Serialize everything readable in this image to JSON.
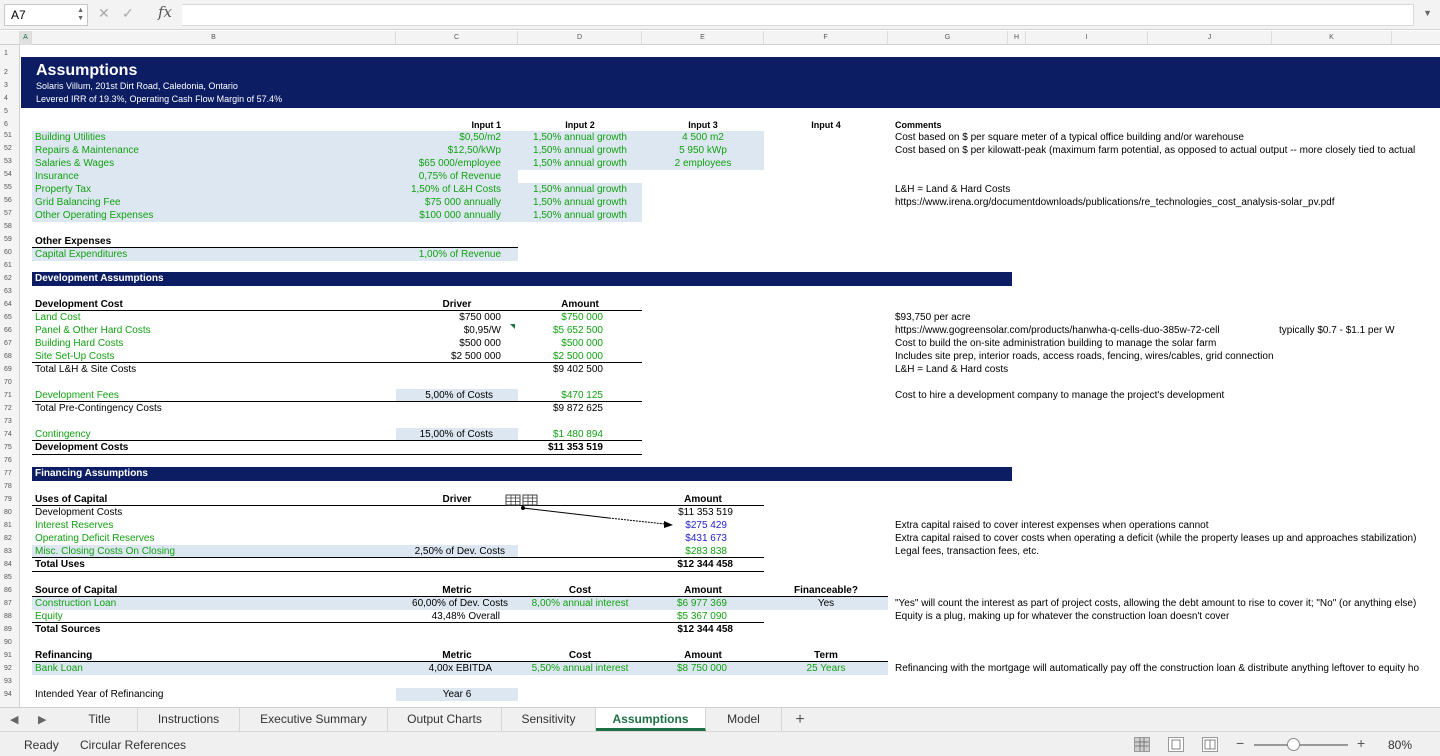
{
  "formula_bar": {
    "cell_ref": "A7",
    "formula": ""
  },
  "columns": [
    "A",
    "B",
    "C",
    "D",
    "E",
    "F",
    "G",
    "H",
    "I",
    "J",
    "K"
  ],
  "rows": [
    "1",
    "2",
    "3",
    "4",
    "5",
    "6",
    "51",
    "52",
    "53",
    "54",
    "55",
    "56",
    "57",
    "58",
    "59",
    "60",
    "61",
    "62",
    "63",
    "64",
    "65",
    "66",
    "67",
    "68",
    "69",
    "70",
    "71",
    "72",
    "73",
    "74",
    "75",
    "76",
    "77",
    "78",
    "79",
    "80",
    "81",
    "82",
    "83",
    "84",
    "85",
    "86",
    "87",
    "88",
    "89",
    "90",
    "91",
    "92",
    "93",
    "94"
  ],
  "header": {
    "title": "Assumptions",
    "subtitle": "Solaris Villum, 201st Dirt Road, Caledonia, Ontario",
    "irr_line": "Levered IRR of 19.3%, Operating Cash Flow Margin of 57.4%"
  },
  "opex": {
    "col_headers": {
      "input1": "Input 1",
      "input2": "Input 2",
      "input3": "Input 3",
      "input4": "Input 4",
      "comments": "Comments"
    },
    "rows": [
      {
        "label": "Building Utilities",
        "in1": "$0,50/m2",
        "in2": "1,50% annual growth",
        "in3": "4 500 m2",
        "comment": "Cost based on $ per square meter of a typical office building and/or warehouse"
      },
      {
        "label": "Repairs & Maintenance",
        "in1": "$12,50/kWp",
        "in2": "1,50% annual growth",
        "in3": "5 950 kWp",
        "comment": "Cost based on $ per kilowatt-peak (maximum farm potential, as opposed to actual output -- more closely tied to actual"
      },
      {
        "label": "Salaries & Wages",
        "in1": "$65 000/employee",
        "in2": "1,50% annual growth",
        "in3": "2 employees",
        "comment": ""
      },
      {
        "label": "Insurance",
        "in1": "0,75% of Revenue",
        "in2": "",
        "in3": "",
        "comment": ""
      },
      {
        "label": "Property Tax",
        "in1": "1,50% of L&H Costs",
        "in2": "1,50% annual growth",
        "in3": "",
        "comment": "L&H = Land & Hard Costs"
      },
      {
        "label": "Grid Balancing Fee",
        "in1": "$75 000 annually",
        "in2": "1,50% annual growth",
        "in3": "",
        "comment": "https://www.irena.org/documentdownloads/publications/re_technologies_cost_analysis-solar_pv.pdf"
      },
      {
        "label": "Other Operating Expenses",
        "in1": "$100 000 annually",
        "in2": "1,50% annual growth",
        "in3": "",
        "comment": ""
      }
    ]
  },
  "other_expenses": {
    "title": "Other Expenses",
    "capex_label": "Capital Expenditures",
    "capex_value": "1,00% of Revenue"
  },
  "development": {
    "band": "Development Assumptions",
    "hdr_label": "Development Cost",
    "hdr_driver": "Driver",
    "hdr_amount": "Amount",
    "rows": [
      {
        "label": "Land Cost",
        "driver": "$750 000",
        "amount": "$750 000",
        "comment": "$93,750 per acre",
        "extra": ""
      },
      {
        "label": "Panel & Other Hard Costs",
        "driver": "$0,95/W",
        "amount": "$5 652 500",
        "comment": "https://www.gogreensolar.com/products/hanwha-q-cells-duo-385w-72-cell",
        "extra": "typically $0.7 - $1.1 per W"
      },
      {
        "label": "Building Hard Costs",
        "driver": "$500 000",
        "amount": "$500 000",
        "comment": "Cost to build the on-site administration building to manage the solar farm",
        "extra": ""
      },
      {
        "label": "Site Set-Up Costs",
        "driver": "$2 500 000",
        "amount": "$2 500 000",
        "comment": "Includes site prep, interior roads, access roads, fencing, wires/cables, grid connection",
        "extra": ""
      }
    ],
    "total_lh_label": "Total L&H & Site Costs",
    "total_lh_amount": "$9 402 500",
    "total_lh_comment": "L&H = Land & Hard costs",
    "dev_fees_label": "Development Fees",
    "dev_fees_driver": "5,00% of Costs",
    "dev_fees_amount": "$470 125",
    "dev_fees_comment": "Cost to hire a development company to manage the project's development",
    "pre_cont_label": "Total Pre-Contingency Costs",
    "pre_cont_amount": "$9 872 625",
    "contingency_label": "Contingency",
    "contingency_driver": "15,00% of Costs",
    "contingency_amount": "$1 480 894",
    "dev_costs_label": "Development Costs",
    "dev_costs_amount": "$11 353 519"
  },
  "financing": {
    "band": "Financing Assumptions",
    "uses_label": "Uses of Capital",
    "uses_driver": "Driver",
    "uses_amount": "Amount",
    "uses": [
      {
        "label": "Development Costs",
        "driver": "",
        "amount": "$11 353 519",
        "comment": ""
      },
      {
        "label": "Interest Reserves",
        "driver": "",
        "amount": "$275 429",
        "comment": "Extra capital raised to cover interest expenses when operations cannot"
      },
      {
        "label": "Operating Deficit Reserves",
        "driver": "",
        "amount": "$431 673",
        "comment": "Extra capital raised to cover costs when operating a deficit (while the property leases up and approaches stabilization)"
      },
      {
        "label": "Misc. Closing Costs On Closing",
        "driver": "2,50% of Dev. Costs",
        "amount": "$283 838",
        "comment": "Legal fees, transaction fees, etc."
      }
    ],
    "total_uses_label": "Total Uses",
    "total_uses_amount": "$12 344 458",
    "source_label": "Source of Capital",
    "source_metric": "Metric",
    "source_cost": "Cost",
    "source_amount": "Amount",
    "source_financeable": "Financeable?",
    "construction_label": "Construction Loan",
    "construction_metric": "60,00% of Dev. Costs",
    "construction_cost": "8,00% annual interest",
    "construction_amount": "$6 977 369",
    "construction_fin": "Yes",
    "construction_comment": "\"Yes\" will count the interest as part of project costs, allowing the debt amount to rise to cover it; \"No\" (or anything else)",
    "equity_label": "Equity",
    "equity_metric": "43,48% Overall",
    "equity_amount": "$5 367 090",
    "equity_comment": "Equity is a plug, making up for whatever the construction loan doesn't cover",
    "total_sources_label": "Total Sources",
    "total_sources_amount": "$12 344 458",
    "refi_label": "Refinancing",
    "refi_metric": "Metric",
    "refi_cost": "Cost",
    "refi_amount": "Amount",
    "refi_term": "Term",
    "bank_label": "Bank Loan",
    "bank_metric": "4,00x EBITDA",
    "bank_cost": "5,50% annual interest",
    "bank_amount": "$8 750 000",
    "bank_term": "25 Years",
    "bank_comment": "Refinancing with the mortgage will automatically pay off the construction loan & distribute anything leftover to equity ho",
    "intended_label": "Intended Year of Refinancing",
    "intended_value": "Year 6"
  },
  "sheet_tabs": [
    "Title",
    "Instructions",
    "Executive Summary",
    "Output Charts",
    "Sensitivity",
    "Assumptions",
    "Model"
  ],
  "active_tab": "Assumptions",
  "status": {
    "ready": "Ready",
    "circular": "Circular References",
    "zoom": "80%"
  },
  "colors": {
    "band": "#0c1d63",
    "input_fill": "#dde7f1",
    "input_text": "#12a112",
    "link_text": "#2222cc",
    "accent": "#1e7145"
  }
}
